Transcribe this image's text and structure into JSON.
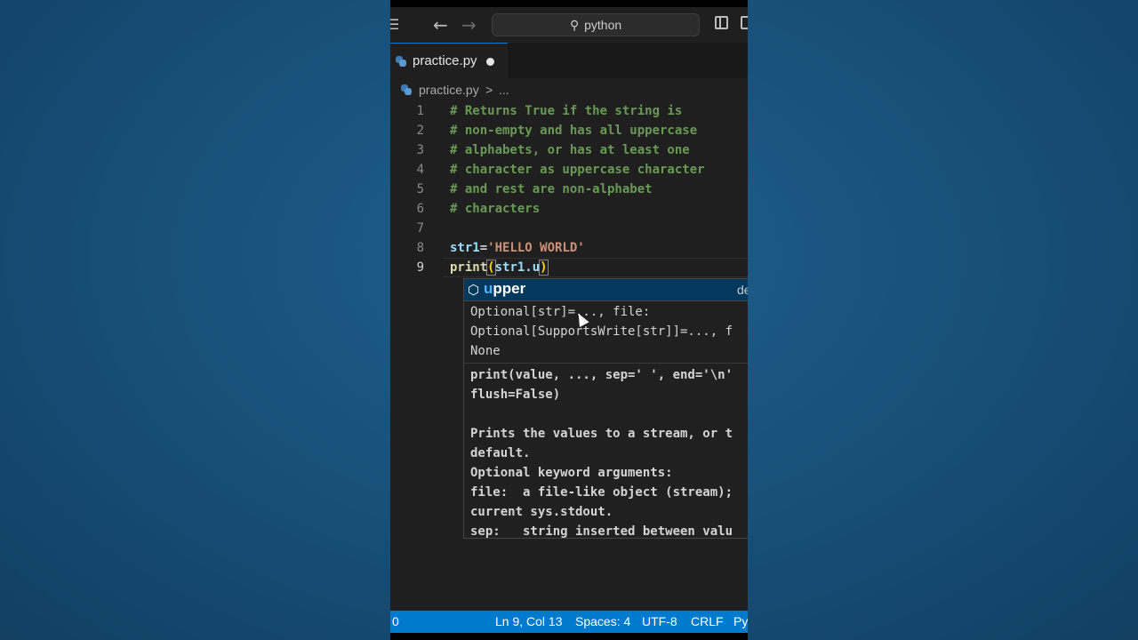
{
  "titlebar": {
    "search_text": "python"
  },
  "tab": {
    "filename": "practice.py"
  },
  "breadcrumb": {
    "file": "practice.py",
    "separator": ">",
    "rest": "..."
  },
  "editor": {
    "lines": [
      {
        "number": "1",
        "text": "# Returns True if the string is"
      },
      {
        "number": "2",
        "text": "# non-empty and has all uppercase"
      },
      {
        "number": "3",
        "text": "# alphabets, or has at least one"
      },
      {
        "number": "4",
        "text": "# character as uppercase character"
      },
      {
        "number": "5",
        "text": "# and rest are non-alphabet"
      },
      {
        "number": "6",
        "text": "# characters"
      },
      {
        "number": "7",
        "text": ""
      },
      {
        "number": "8",
        "var": "str1",
        "op": "=",
        "str": "'HELLO WORLD'"
      },
      {
        "number": "9",
        "fn": "print",
        "open": "(",
        "arg": "str1.u",
        "close": ")"
      }
    ]
  },
  "suggestion": {
    "match": "u",
    "rest": "pper",
    "detail": "de"
  },
  "docs": {
    "signature_lines": [
      "Optional[str]=..., file:",
      "Optional[SupportsWrite[str]]=..., f",
      "None"
    ],
    "body_lines": [
      "print(value, ..., sep=' ', end='\\n'",
      "flush=False)",
      "",
      "Prints the values to a stream, or t",
      "default.",
      "Optional keyword arguments:",
      "file:  a file-like object (stream);",
      "current sys.stdout.",
      "sep:   string inserted between valu"
    ]
  },
  "statusbar": {
    "left": "0",
    "position": "Ln 9, Col 13",
    "spaces": "Spaces: 4",
    "encoding": "UTF-8",
    "eol": "CRLF",
    "language": "Py"
  }
}
